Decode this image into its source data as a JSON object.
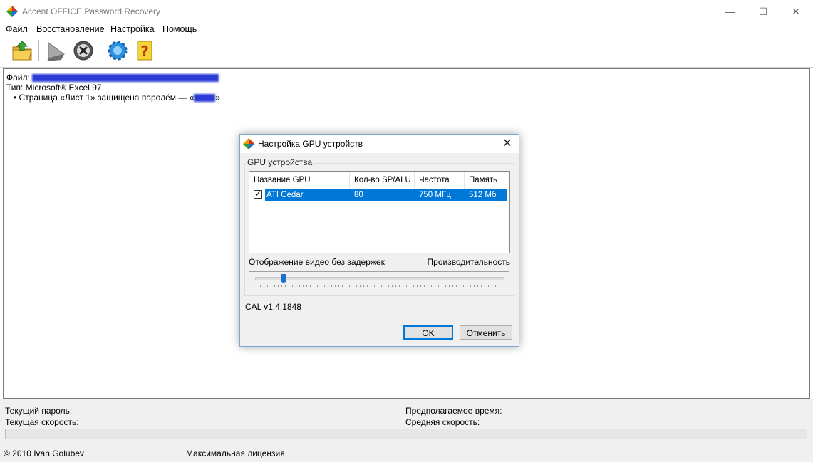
{
  "window": {
    "title": "Accent OFFICE Password Recovery",
    "controls": {
      "minimize": "—",
      "maximize": "☐",
      "close": "✕"
    }
  },
  "menu": [
    "Файл",
    "Восстановление",
    "Настройка",
    "Помощь"
  ],
  "toolbar": {
    "buttons": [
      "open-folder-icon",
      "play-icon",
      "stop-icon",
      "settings-gear-icon",
      "help-question-icon"
    ]
  },
  "file_info": {
    "file_label": "Файл:",
    "type_line": "Тип: Microsoft® Excel 97",
    "sheet_prefix": "• Страница «Лист 1» защищена паролём — «",
    "sheet_suffix": "»"
  },
  "status": {
    "current_password_label": "Текущий пароль:",
    "current_speed_label": "Текущая скорость:",
    "estimated_time_label": "Предполагаемое время:",
    "average_speed_label": "Средняя скорость:"
  },
  "statusbar": {
    "copyright": "© 2010 Ivan Golubev",
    "license": "Максимальная лицензия"
  },
  "dialog": {
    "title": "Настройка GPU устройств",
    "close": "✕",
    "group_label": "GPU устройства",
    "columns": [
      "Название GPU",
      "Кол-во SP/ALU",
      "Частота",
      "Память"
    ],
    "rows": [
      {
        "checked": true,
        "name": "ATI Cedar",
        "sp": "80",
        "freq": "750 МГц",
        "mem": "512 Мб"
      }
    ],
    "slider_left_label": "Отображение видео без задержек",
    "slider_right_label": "Производительность",
    "slider_level": 0.1,
    "cal_version": "CAL v1.4.1848",
    "ok_label": "OK",
    "cancel_label": "Отменить",
    "check_mark": "✓"
  }
}
